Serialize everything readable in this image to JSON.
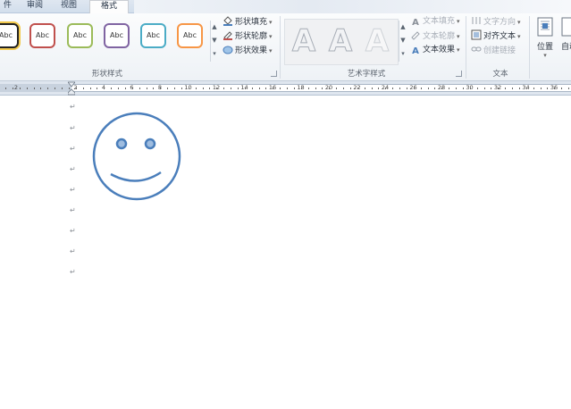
{
  "tabs": [
    {
      "label": "件",
      "active": false
    },
    {
      "label": "审阅",
      "active": false
    },
    {
      "label": "视图",
      "active": false
    },
    {
      "label": "格式",
      "active": true
    }
  ],
  "shape_styles": {
    "group_label": "形状样式",
    "gallery": [
      {
        "text": "Abc",
        "color": "#222222"
      },
      {
        "text": "Abc",
        "color": "#c0504d"
      },
      {
        "text": "Abc",
        "color": "#9bbb59"
      },
      {
        "text": "Abc",
        "color": "#8064a2"
      },
      {
        "text": "Abc",
        "color": "#4bacc6"
      },
      {
        "text": "Abc",
        "color": "#f79646"
      }
    ],
    "commands": {
      "fill": "形状填充",
      "outline": "形状轮廓",
      "effects": "形状效果"
    }
  },
  "wordart_styles": {
    "group_label": "艺术字样式",
    "gallery_letter": "A",
    "commands": {
      "text_fill": "文本填充",
      "text_outline": "文本轮廓",
      "text_effects": "文本效果"
    }
  },
  "text_group": {
    "group_label": "文本",
    "commands": {
      "text_direction": "文字方向",
      "align_text": "对齐文本",
      "create_link": "创建链接"
    }
  },
  "arrange": {
    "position_label": "位置",
    "wrap_label": "自动"
  },
  "ruler": {
    "labels": [
      "2",
      "2",
      "4",
      "6",
      "8",
      "10",
      "12",
      "14",
      "16",
      "18",
      "20",
      "22",
      "24",
      "26",
      "28",
      "30",
      "32",
      "34",
      "36"
    ]
  },
  "document": {
    "paragraph_mark": "↵",
    "shape": "smiley-face",
    "shape_color": "#4a7ebb"
  }
}
